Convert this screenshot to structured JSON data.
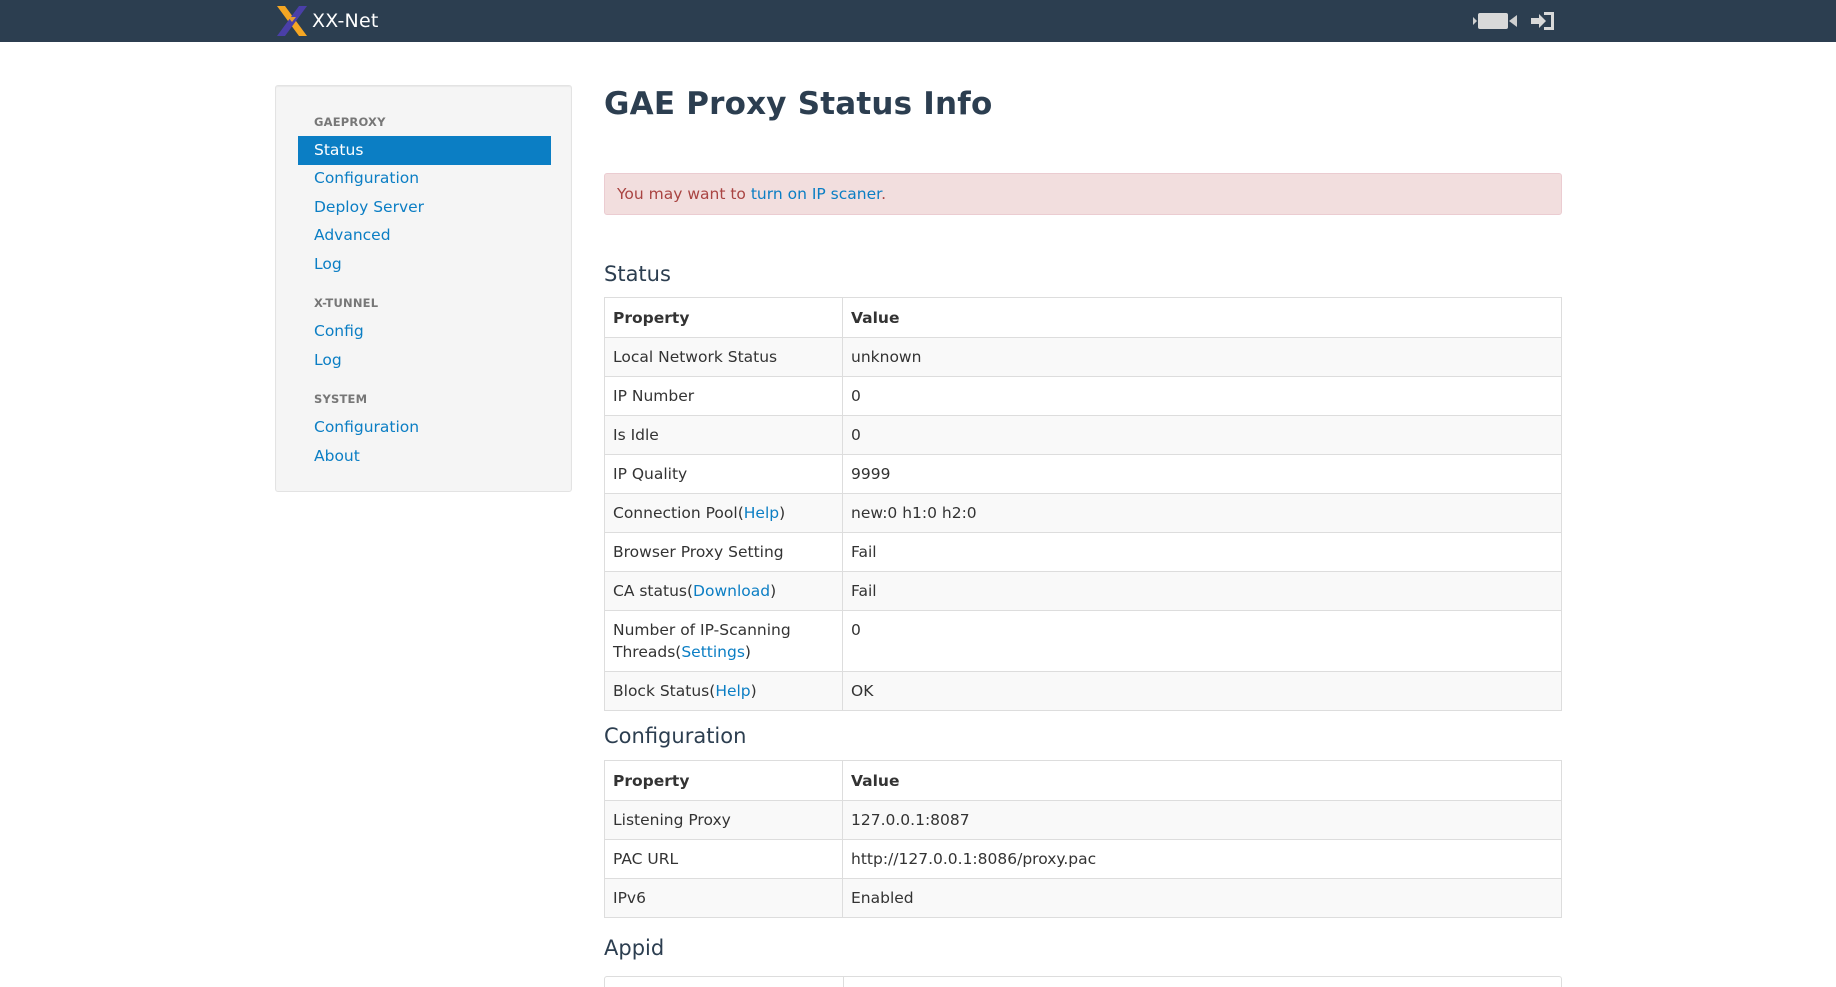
{
  "navbar": {
    "brand": "XX-Net",
    "icons": [
      "video-camera-icon",
      "sign-out-icon"
    ]
  },
  "sidebar": {
    "sections": [
      {
        "header": "GAEPROXY",
        "items": [
          "Status",
          "Configuration",
          "Deploy Server",
          "Advanced",
          "Log"
        ]
      },
      {
        "header": "X-TUNNEL",
        "items": [
          "Config",
          "Log"
        ]
      },
      {
        "header": "SYSTEM",
        "items": [
          "Configuration",
          "About"
        ]
      }
    ],
    "active": "Status"
  },
  "main": {
    "title": "GAE Proxy Status Info",
    "alert": {
      "before": "You may want to ",
      "link": "turn on IP scaner",
      "after": "."
    },
    "status": {
      "heading": "Status",
      "col_property": "Property",
      "col_value": "Value",
      "rows": [
        {
          "property": "Local Network Status",
          "value": "unknown"
        },
        {
          "property": "IP Number",
          "value": "0"
        },
        {
          "property": "Is Idle",
          "value": "0"
        },
        {
          "property": "IP Quality",
          "value": "9999"
        },
        {
          "property": "Connection Pool",
          "link": "Help",
          "value": "new:0 h1:0 h2:0"
        },
        {
          "property": "Browser Proxy Setting",
          "value": "Fail"
        },
        {
          "property": "CA status",
          "link": "Download",
          "value": "Fail"
        },
        {
          "property": "Number of IP-Scanning Threads",
          "link": "Settings",
          "value": "0"
        },
        {
          "property": "Block Status",
          "link": "Help",
          "value": "OK"
        }
      ]
    },
    "configuration": {
      "heading": "Configuration",
      "col_property": "Property",
      "col_value": "Value",
      "rows": [
        {
          "property": "Listening Proxy",
          "value": "127.0.0.1:8087"
        },
        {
          "property": "PAC URL",
          "value": "http://127.0.0.1:8086/proxy.pac"
        },
        {
          "property": "IPv6",
          "value": "Enabled"
        }
      ]
    },
    "appid": {
      "heading": "Appid"
    }
  },
  "colors": {
    "navbar": "#2c3e50",
    "accent": "#0b7ec4",
    "alert_bg": "#f2dede",
    "alert_text": "#a94442",
    "title": "#2c3e50"
  }
}
